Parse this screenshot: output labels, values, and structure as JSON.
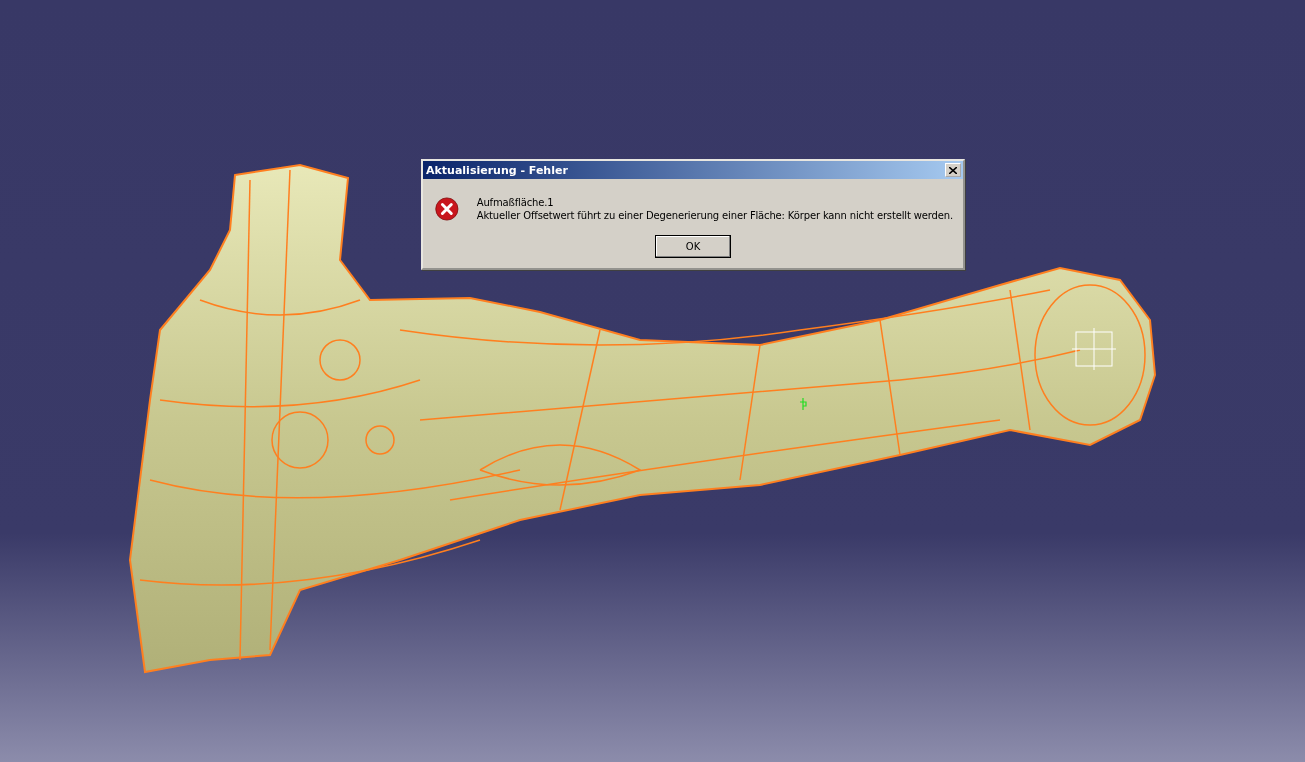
{
  "dialog": {
    "title": "Aktualisierung - Fehler",
    "feature": "Aufmaßfläche.1",
    "message": "Aktueller Offsetwert führt zu einer Degenerierung einer Fläche: Körper kann nicht erstellt werden.",
    "buttons": [
      "OK"
    ]
  }
}
